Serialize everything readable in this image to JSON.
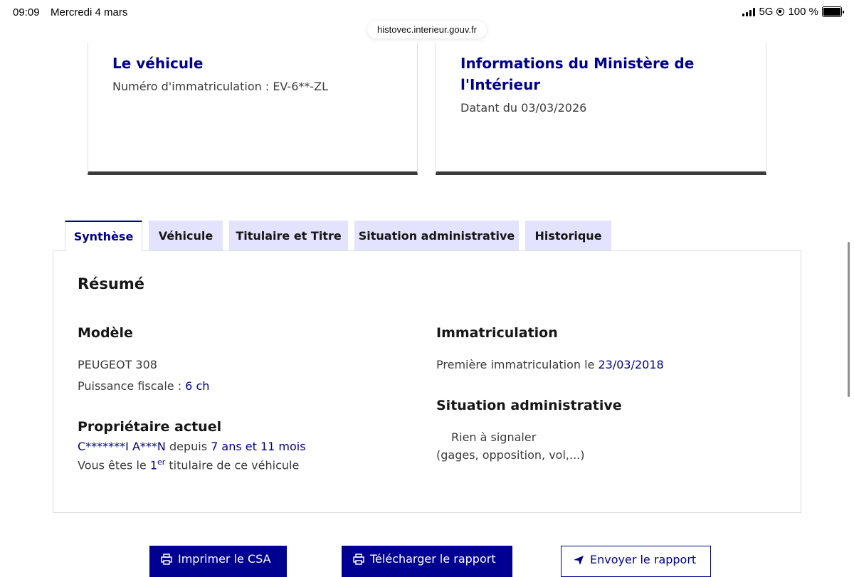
{
  "status_bar": {
    "time": "09:09",
    "date": "Mercredi 4 mars",
    "network": "5G",
    "battery": "100 %"
  },
  "browser": {
    "url": "histovec.interieur.gouv.fr"
  },
  "cards": {
    "vehicle": {
      "title": "Le véhicule",
      "plate_label": "Numéro d'immatriculation : ",
      "plate_value": "EV-6**-ZL"
    },
    "ministry": {
      "title": "Informations du Ministère de l'Intérieur",
      "date_label": "Datant du ",
      "date_value": "03/03/2026"
    }
  },
  "tabs": [
    {
      "label": "Synthèse",
      "active": true
    },
    {
      "label": "Véhicule",
      "active": false
    },
    {
      "label": "Titulaire et Titre",
      "active": false
    },
    {
      "label": "Situation administrative",
      "active": false
    },
    {
      "label": "Historique",
      "active": false
    }
  ],
  "summary": {
    "title": "Résumé",
    "model": {
      "heading": "Modèle",
      "name": "PEUGEOT 308",
      "power_label": "Puissance fiscale : ",
      "power_value": "6 ch"
    },
    "owner": {
      "heading": "Propriétaire actuel",
      "name": "C*******I A***N",
      "since_label": " depuis ",
      "since_value": "7 ans et 11 mois",
      "rank_prefix": "Vous êtes le ",
      "rank_number": "1",
      "rank_sup": "er",
      "rank_suffix": " titulaire de ce véhicule"
    },
    "registration": {
      "heading": "Immatriculation",
      "first_label": "Première immatriculation le ",
      "first_date": "23/03/2018"
    },
    "admin": {
      "heading": "Situation administrative",
      "status": "Rien à signaler",
      "note": "(gages, opposition, vol,...)"
    }
  },
  "actions": {
    "print_csa": "Imprimer le CSA",
    "download_report": "Télécharger le rapport",
    "send_report": "Envoyer le rapport"
  },
  "colors": {
    "accent": "#000091",
    "tab_background": "#e3e3fd",
    "text": "#3a3a3a",
    "border": "#dddddd"
  }
}
